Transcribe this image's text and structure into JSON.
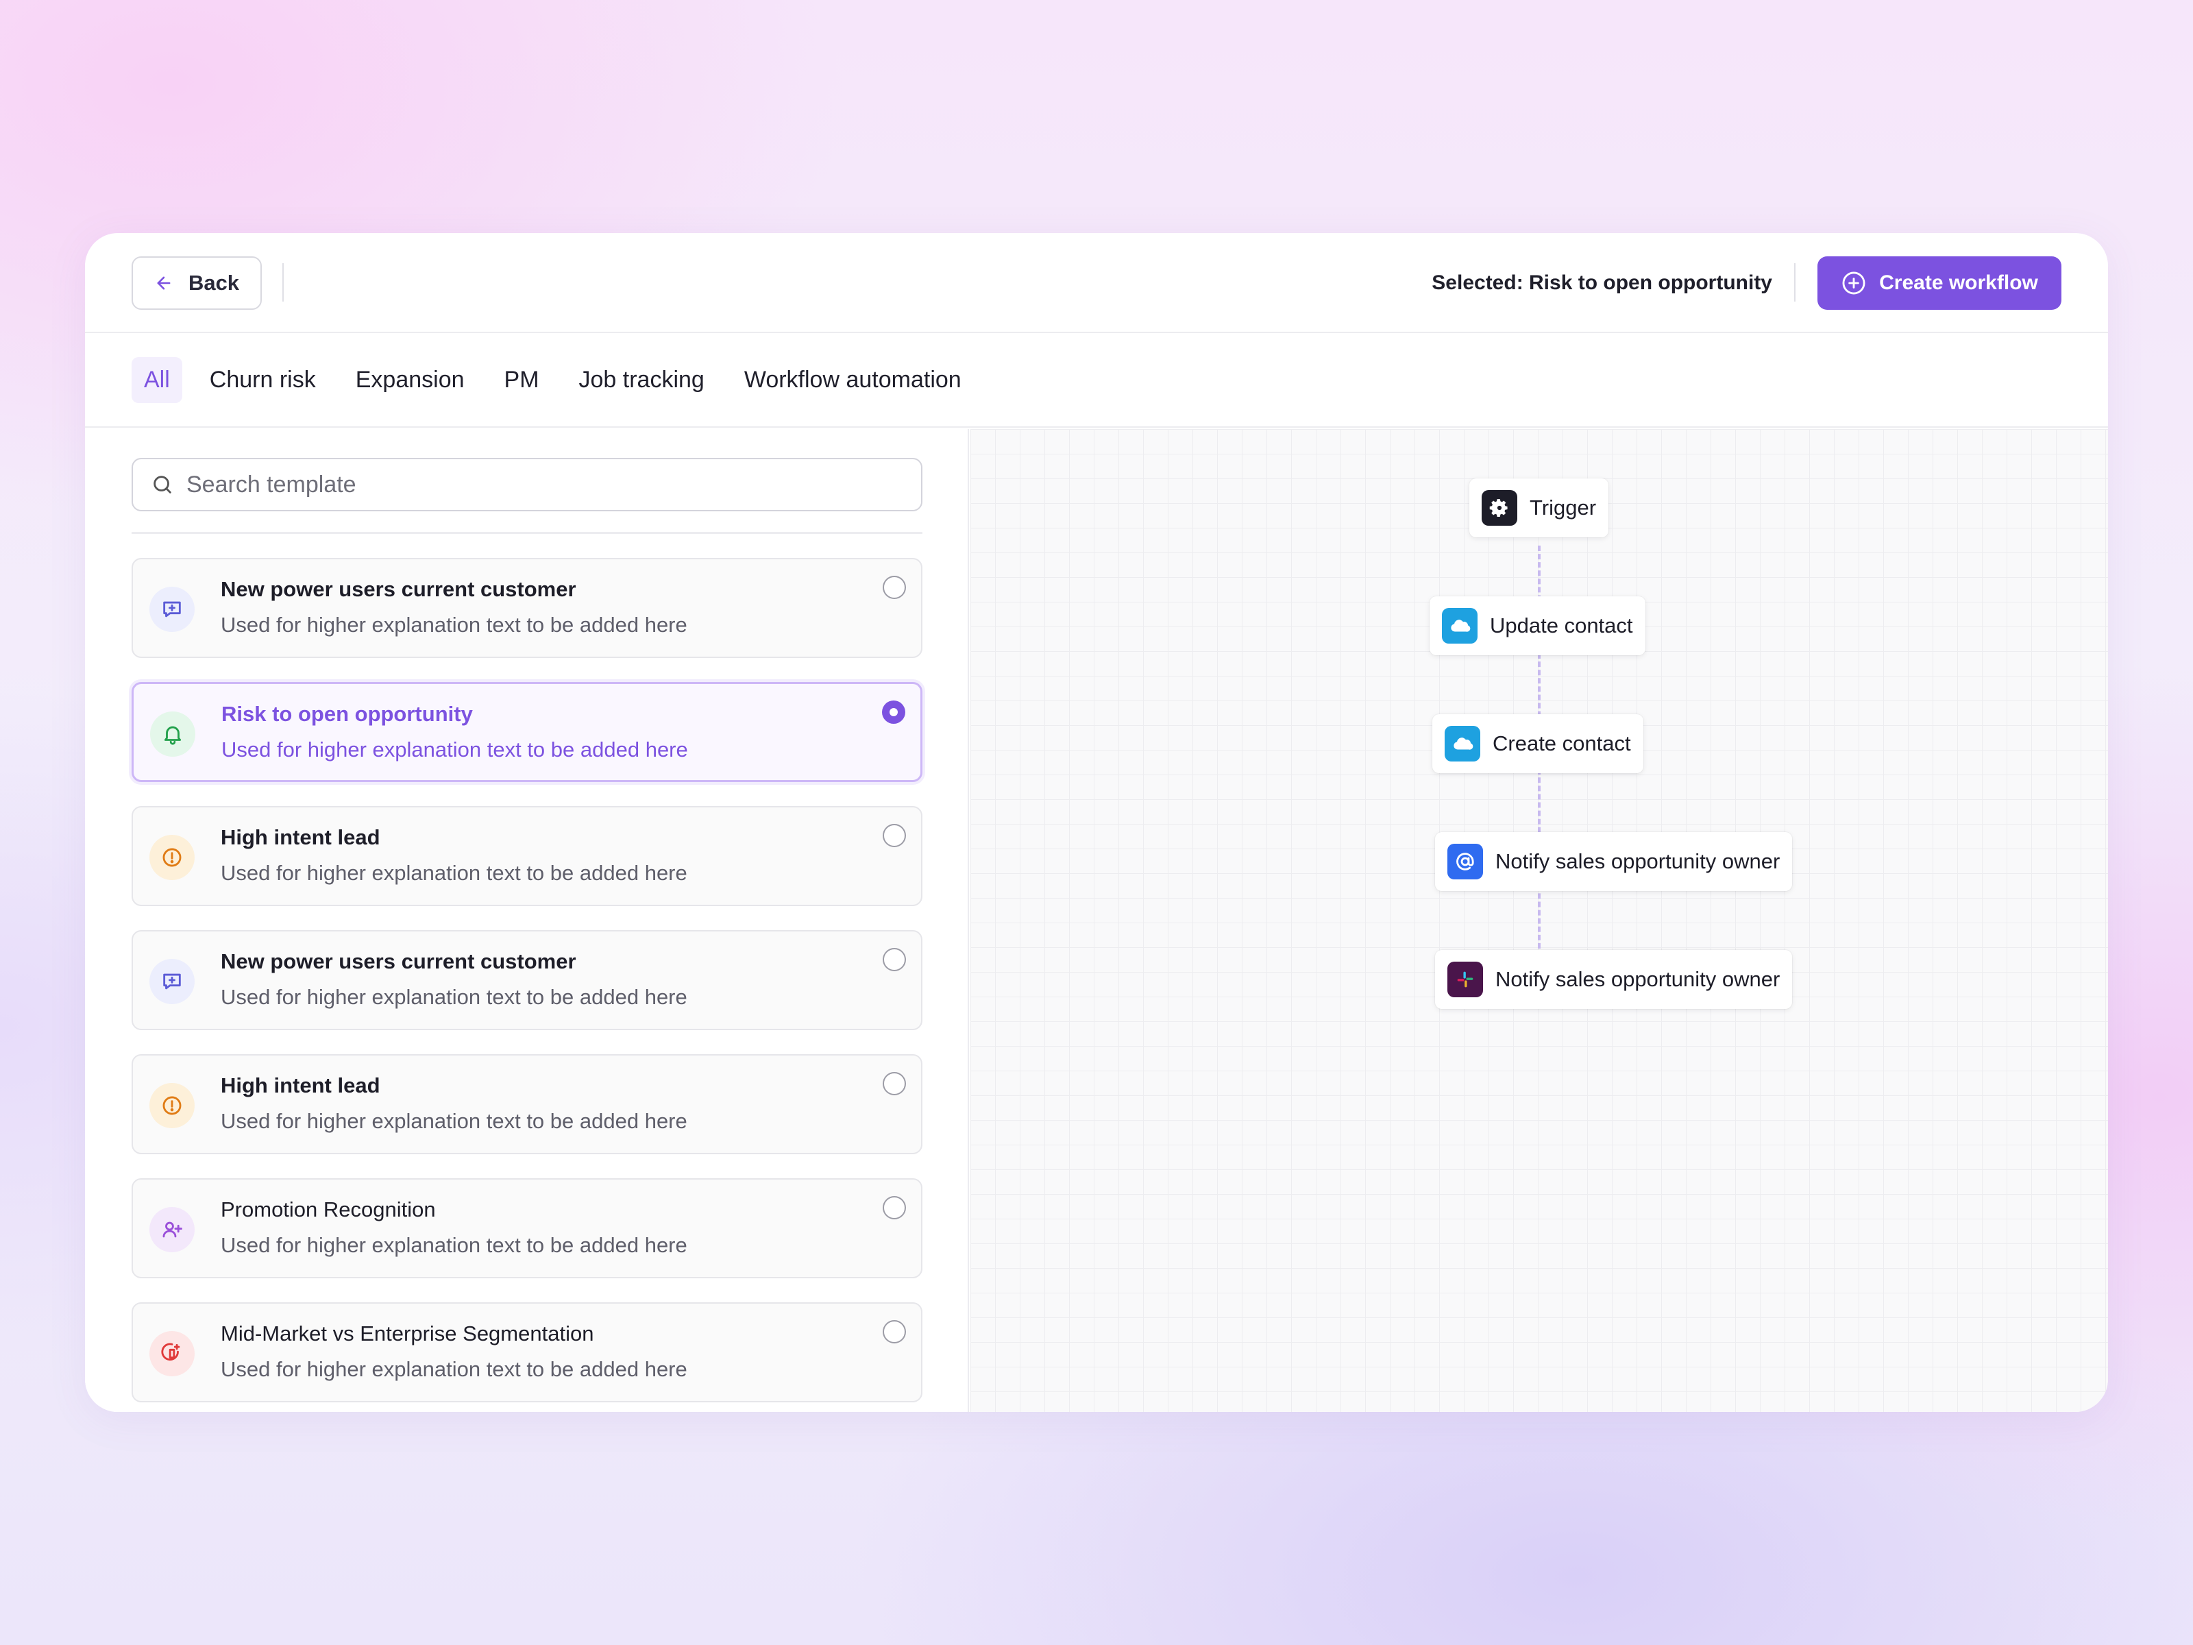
{
  "header": {
    "back_label": "Back",
    "selected_text": "Selected: Risk to open opportunity",
    "create_label": "Create workflow"
  },
  "tabs": [
    {
      "label": "All",
      "active": true
    },
    {
      "label": "Churn risk",
      "active": false
    },
    {
      "label": "Expansion",
      "active": false
    },
    {
      "label": "PM",
      "active": false
    },
    {
      "label": "Job tracking",
      "active": false
    },
    {
      "label": "Workflow automation",
      "active": false
    }
  ],
  "search": {
    "placeholder": "Search template",
    "value": ""
  },
  "templates": [
    {
      "title": "New power users current customer",
      "desc": "Used for higher explanation text to be added here",
      "icon": "chat-plus-icon",
      "icon_color": "#5b5bd6",
      "icon_bg": "#eceefd",
      "selected": false
    },
    {
      "title": "Risk to open opportunity",
      "desc": "Used for higher explanation text to be added here",
      "icon": "bell-icon",
      "icon_color": "#22a04b",
      "icon_bg": "#e4f7ea",
      "selected": true
    },
    {
      "title": "High intent lead",
      "desc": "Used for higher explanation text to be added here",
      "icon": "alert-circle-icon",
      "icon_color": "#e07b14",
      "icon_bg": "#fdf0d9",
      "selected": false
    },
    {
      "title": "New power users current customer",
      "desc": "Used for higher explanation text to be added here",
      "icon": "chat-plus-icon",
      "icon_color": "#5b5bd6",
      "icon_bg": "#eceefd",
      "selected": false
    },
    {
      "title": "High intent lead",
      "desc": "Used for higher explanation text to be added here",
      "icon": "alert-circle-icon",
      "icon_color": "#e07b14",
      "icon_bg": "#fdf0d9",
      "selected": false
    },
    {
      "title": "Promotion Recognition",
      "desc": "Used for higher explanation text to be added here",
      "icon": "user-plus-icon",
      "icon_color": "#9a4fd9",
      "icon_bg": "#f3e8fb",
      "selected": false
    },
    {
      "title": "Mid-Market vs Enterprise Segmentation",
      "desc": "Used for higher explanation text to be added here",
      "icon": "segment-icon",
      "icon_color": "#e03a3a",
      "icon_bg": "#fde6e6",
      "selected": false
    }
  ],
  "workflow": {
    "nodes": [
      {
        "label": "Trigger",
        "icon": "gear-icon",
        "icon_bg": "#1d1d28"
      },
      {
        "label": "Update contact",
        "icon": "salesforce-cloud-icon",
        "icon_bg": "#1ea1e0"
      },
      {
        "label": "Create contact",
        "icon": "salesforce-cloud-icon",
        "icon_bg": "#1ea1e0"
      },
      {
        "label": "Notify sales opportunity owner",
        "icon": "at-sign-icon",
        "icon_bg": "#2f6bf0"
      },
      {
        "label": "Notify sales opportunity owner",
        "icon": "slack-icon",
        "icon_bg": "#4a154b"
      }
    ]
  },
  "colors": {
    "accent": "#7c52e0"
  }
}
